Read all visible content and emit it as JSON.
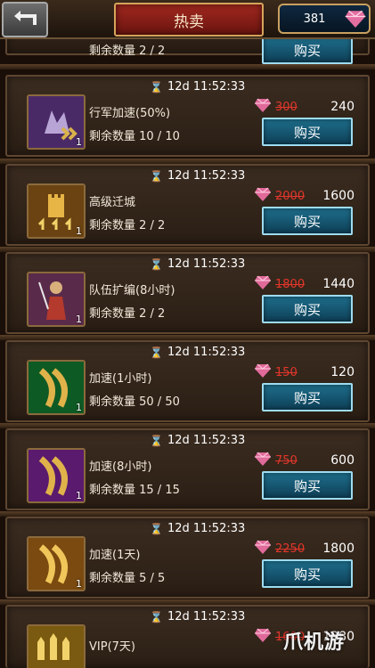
{
  "header": {
    "title": "热卖",
    "gem_count": "381"
  },
  "partial_top": {
    "remain": "剩余数量   2 / 2",
    "buy_label": "购买"
  },
  "items": [
    {
      "timer": "12d 11:52:33",
      "name": "行军加速(50%)",
      "remain": "剩余数量   10 / 10",
      "old_price": "300",
      "price": "240",
      "qty": "1",
      "buy": "购买",
      "icon": "march-speedup-icon"
    },
    {
      "timer": "12d 11:52:33",
      "name": "高级迁城",
      "remain": "剩余数量   2 / 2",
      "old_price": "2000",
      "price": "1600",
      "qty": "1",
      "buy": "购买",
      "icon": "relocate-castle-icon"
    },
    {
      "timer": "12d 11:52:33",
      "name": "队伍扩编(8小时)",
      "remain": "剩余数量   2 / 2",
      "old_price": "1800",
      "price": "1440",
      "qty": "1",
      "buy": "购买",
      "icon": "troop-expand-icon"
    },
    {
      "timer": "12d 11:52:33",
      "name": "加速(1小时)",
      "remain": "剩余数量   50 / 50",
      "old_price": "150",
      "price": "120",
      "qty": "1",
      "buy": "购买",
      "icon": "speedup-1h-icon"
    },
    {
      "timer": "12d 11:52:33",
      "name": "加速(8小时)",
      "remain": "剩余数量   15 / 15",
      "old_price": "750",
      "price": "600",
      "qty": "1",
      "buy": "购买",
      "icon": "speedup-8h-icon"
    },
    {
      "timer": "12d 11:52:33",
      "name": "加速(1天)",
      "remain": "剩余数量   5 / 5",
      "old_price": "2250",
      "price": "1800",
      "qty": "1",
      "buy": "购买",
      "icon": "speedup-1d-icon"
    },
    {
      "timer": "12d 11:52:33",
      "name": "VIP(7天)",
      "remain": "",
      "old_price": "1600",
      "price": "1280",
      "qty": "",
      "buy": "",
      "icon": "vip-icon"
    }
  ],
  "watermark": "爪机游"
}
